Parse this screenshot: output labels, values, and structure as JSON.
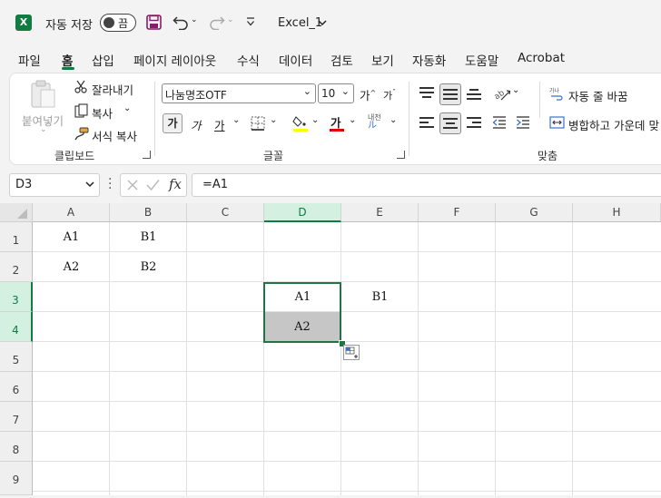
{
  "titlebar": {
    "app_icon": "X",
    "autosave_label": "자동 저장",
    "autosave_state": "끔",
    "filename": "Excel_1"
  },
  "tabs": [
    "파일",
    "홈",
    "삽입",
    "페이지 레이아웃",
    "수식",
    "데이터",
    "검토",
    "보기",
    "자동화",
    "도움말",
    "Acrobat"
  ],
  "active_tab": "홈",
  "ribbon": {
    "clipboard": {
      "paste_label": "붙여넣기",
      "cut_label": "잘라내기",
      "copy_label": "복사",
      "format_painter_label": "서식 복사",
      "group_label": "클립보드"
    },
    "font": {
      "font_name": "나눔명조OTF",
      "font_size": "10",
      "group_label": "글꼴",
      "bold_glyph": "가",
      "italic_glyph": "가",
      "underline_glyph": "가",
      "font_color_glyph": "가",
      "grow_glyph": "가",
      "shrink_glyph": "가",
      "phonetic_glyph": "내천"
    },
    "alignment": {
      "wrap_text_label": "자동 줄 바꿈",
      "merge_label": "병합하고 가운데 맞",
      "group_label": "맞춤"
    }
  },
  "formula_bar": {
    "name_box": "D3",
    "fx": "fx",
    "formula": "=A1"
  },
  "sheet": {
    "columns": [
      "A",
      "B",
      "C",
      "D",
      "E",
      "F",
      "G",
      "H"
    ],
    "rows": [
      "1",
      "2",
      "3",
      "4",
      "5",
      "6",
      "7",
      "8",
      "9"
    ],
    "selected_column": "D",
    "selected_rows": [
      "3",
      "4"
    ],
    "cells": {
      "A1": "A1",
      "B1": "B1",
      "A2": "A2",
      "B2": "B2",
      "D3": "A1",
      "E3": "B1",
      "D4": "A2"
    }
  },
  "colors": {
    "accent": "#107c41",
    "selection_border": "#217346",
    "shaded_cell": "#c6c6c6",
    "font_color_bar": "#e00000",
    "highlight_bar": "#ffff00"
  }
}
